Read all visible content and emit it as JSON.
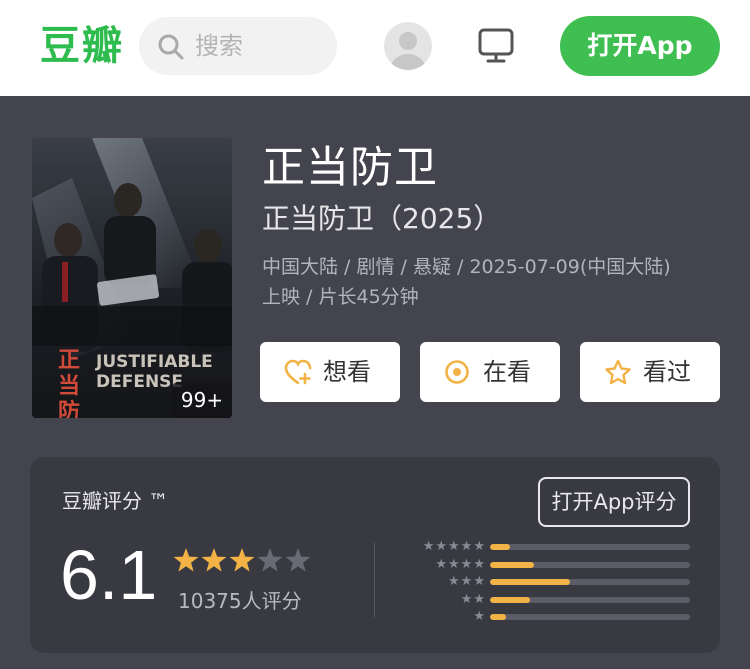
{
  "header": {
    "logo": "豆瓣",
    "search_placeholder": "搜索",
    "open_app": "打开App"
  },
  "movie": {
    "title": "正当防卫",
    "subtitle": "正当防卫（2025）",
    "meta_line1": "中国大陆 / 剧情 / 悬疑 / 2025-07-09(中国大陆)",
    "meta_line2": "上映 / 片长45分钟",
    "poster": {
      "cn_title": "正当防卫",
      "en_title_line1": "JUSTIFIABLE",
      "en_title_line2": "DEFENSE",
      "image_count": "99+"
    }
  },
  "actions": {
    "want": "想看",
    "doing": "在看",
    "done": "看过"
  },
  "rating": {
    "title": "豆瓣评分 ™",
    "open_app_rate": "打开App评分",
    "score": "6.1",
    "stars": 3,
    "count_text": "10375人评分",
    "distribution": [
      {
        "stars": "★★★★★",
        "fraction": 0.1
      },
      {
        "stars": "★★★★",
        "fraction": 0.22
      },
      {
        "stars": "★★★",
        "fraction": 0.4
      },
      {
        "stars": "★★",
        "fraction": 0.2
      },
      {
        "stars": "★",
        "fraction": 0.08
      }
    ]
  },
  "colors": {
    "brand_green": "#3fbf51",
    "star_gold": "#f2b245",
    "star_gray": "#6a6a74"
  }
}
